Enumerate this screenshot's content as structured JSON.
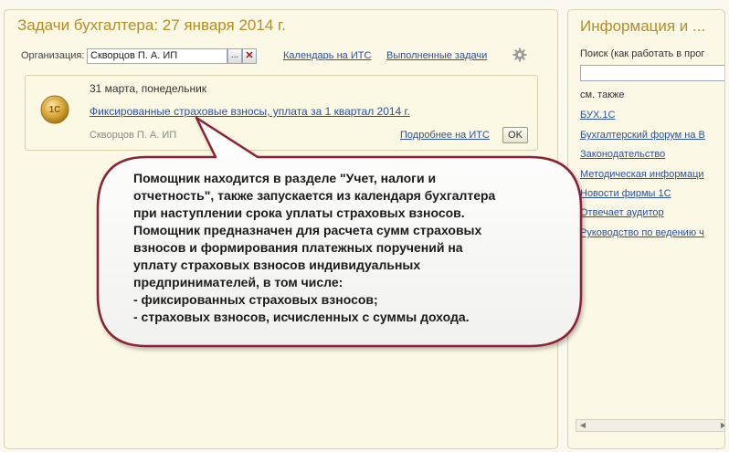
{
  "tasks_panel": {
    "title": "Задачи бухгалтера: 27 января 2014 г.",
    "org_label": "Организация:",
    "org_value": "Скворцов П. А. ИП",
    "org_select_btn": "...",
    "org_clear_btn": "✕",
    "calendar_link": "Календарь на ИТС",
    "done_tasks_link": "Выполненные задачи",
    "settings_icon": "gear-icon",
    "task": {
      "icon": "coin-icon",
      "date": "31 марта, понедельник",
      "title": "Фиксированные страховые взносы, уплата за 1 квартал 2014 г.",
      "organization": "Скворцов П. А. ИП",
      "more_link": "Подробнее на ИТС",
      "ok_button": "OK"
    }
  },
  "callout": {
    "lines": [
      "Помощник находится в разделе \"Учет, налоги и",
      "отчетность\", также запускается из календаря бухгалтера",
      "при наступлении срока уплаты страховых взносов.",
      "Помощник предназначен для расчета сумм страховых",
      "взносов и формирования платежных поручений на",
      "уплату страховых взносов индивидуальных",
      "предпринимателей, в том числе:",
      "- фиксированных страховых взносов;",
      "- страховых взносов, исчисленных с суммы дохода."
    ]
  },
  "info_panel": {
    "title": "Информация и ...",
    "search_label": "Поиск (как работать в прог",
    "search_placeholder": "",
    "see_also": "см. также",
    "links": [
      "БУХ.1С",
      "Бухгалтерский форум на В",
      "Законодательство",
      "Методическая информаци",
      "Новости фирмы 1С",
      "Отвечает аудитор",
      "Руководство по ведению ч"
    ]
  },
  "colors": {
    "title_color": "#b58c26",
    "link_color": "#2a52a0",
    "panel_bg": "#fbf8e6",
    "callout_border": "#8a2130"
  }
}
